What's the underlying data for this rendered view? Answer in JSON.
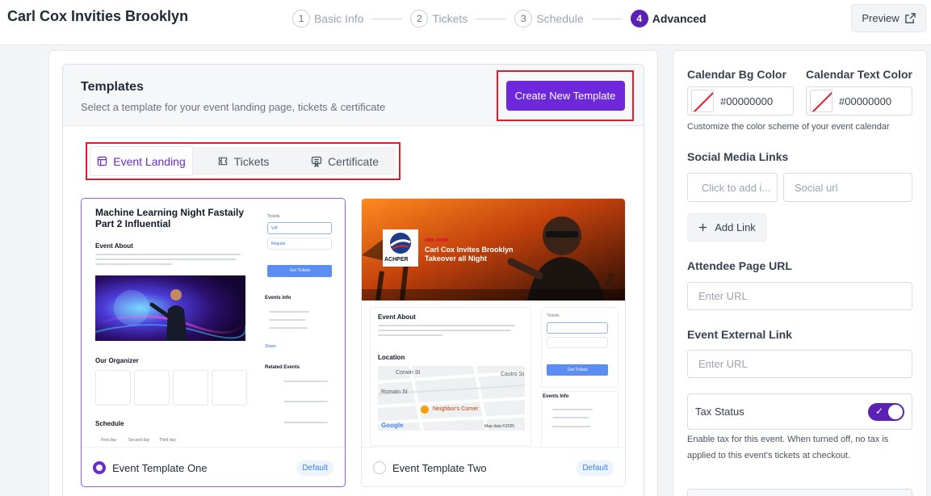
{
  "header": {
    "event_title": "Carl Cox Invities Brooklyn",
    "steps": [
      {
        "num": "1",
        "label": "Basic Info"
      },
      {
        "num": "2",
        "label": "Tickets"
      },
      {
        "num": "3",
        "label": "Schedule"
      },
      {
        "num": "4",
        "label": "Advanced"
      }
    ],
    "preview_label": "Preview"
  },
  "templates": {
    "title": "Templates",
    "subtitle": "Select a template for your event landing page, tickets & certificate",
    "create_label": "Create New Template",
    "tabs": [
      {
        "label": "Event Landing",
        "icon": "layout-icon"
      },
      {
        "label": "Tickets",
        "icon": "ticket-icon"
      },
      {
        "label": "Certificate",
        "icon": "certificate-icon"
      }
    ],
    "cards": [
      {
        "name": "Event Template One",
        "badge": "Default",
        "selected": true,
        "preview": {
          "title": "Machine Learning Night Fastaily Part 2 Influential",
          "event_about": "Event About",
          "tickets": "Tickets",
          "vip": "VIP",
          "regular": "Regular",
          "get_tickets": "Get Tickets",
          "events_info": "Events info",
          "our_organizer": "Our Organizer",
          "related_events": "Related Events",
          "schedule": "Schedule",
          "share": "Share:",
          "first_day": "First day",
          "second_day": "Second day",
          "third_day": "Third day"
        }
      },
      {
        "name": "Event Template Two",
        "badge": "Default",
        "selected": false,
        "preview": {
          "banner_title": "Carl Cox Invites Brooklyn Takeover all Night",
          "logo_text": "ACHPER",
          "event_about": "Event About",
          "location": "Location",
          "tickets": "Tickets",
          "get_tickets": "Get Tickets",
          "events_info": "Events Info",
          "map_pois": [
            "Corwin St",
            "Romain St",
            "Castro St"
          ],
          "map_place": "Neighbor's Corner",
          "map_brand": "Google",
          "map_data": "Map data ©2025"
        }
      }
    ]
  },
  "settings": {
    "calendar_bg": {
      "label": "Calendar Bg Color",
      "value": "#00000000"
    },
    "calendar_text": {
      "label": "Calendar Text Color",
      "value": "#00000000"
    },
    "calendar_help": "Customize the color scheme of your event calendar",
    "social_title": "Social Media Links",
    "social_type_placeholder": "Click to add i...",
    "social_url_placeholder": "Social url",
    "add_link_label": "Add Link",
    "attendee_title": "Attendee Page URL",
    "attendee_placeholder": "Enter URL",
    "external_title": "Event External Link",
    "external_placeholder": "Enter URL",
    "tax_label": "Tax Status",
    "tax_enabled": true,
    "tax_help_1": "Enable tax for this event. When turned off, no tax is",
    "tax_help_2": "applied to this event's tickets at checkout."
  },
  "colors": {
    "accent": "#6d28d9",
    "highlight": "#e11d2a"
  }
}
